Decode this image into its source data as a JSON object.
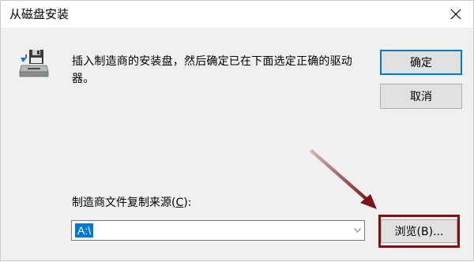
{
  "window": {
    "title": "从磁盘安装",
    "close_icon": "close-icon"
  },
  "body": {
    "icon": "floppy-drive-icon",
    "message": "插入制造商的安装盘，然后确定已在下面选定正确的驱动器。"
  },
  "buttons": {
    "ok_label": "确定",
    "cancel_label": "取消",
    "browse_label": "浏览(B)..."
  },
  "source": {
    "label_prefix": "制造商文件复制来源(",
    "label_accel": "C",
    "label_suffix": "):",
    "value": "A:\\"
  },
  "annotation": {
    "arrow_color": "#7a1216",
    "highlight_color": "#7a1216"
  },
  "colors": {
    "accent": "#0078d7",
    "dialog_bg": "#f0f0f0",
    "button_bg": "#e1e1e1"
  }
}
